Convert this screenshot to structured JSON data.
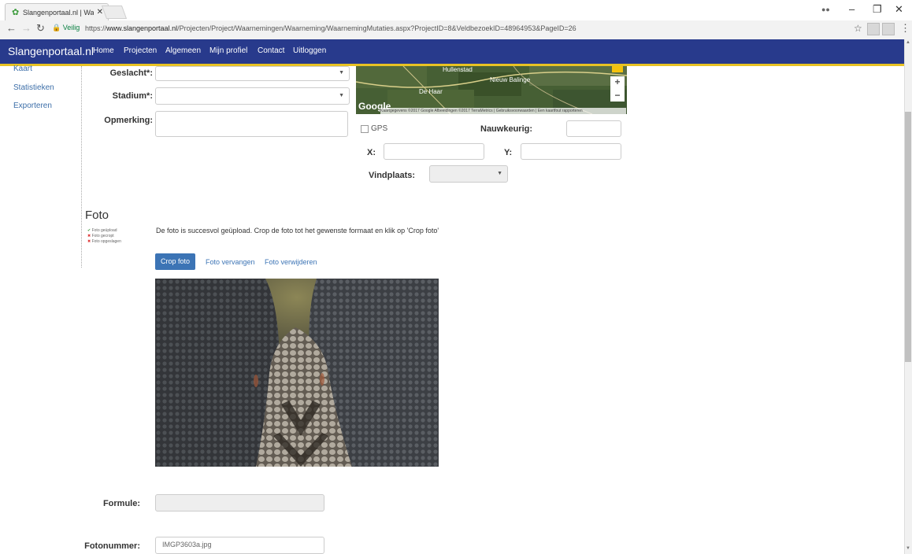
{
  "browser": {
    "tab_title": "Slangenportaal.nl | Waa",
    "secure_label": "Veilig",
    "url_prefix": "https://",
    "url_host": "www.slangenportaal.nl",
    "url_path": "/Projecten/Project/Waarnemingen/Waarneming/WaarnemingMutaties.aspx?ProjectID=8&VeldbezoekID=48964953&PageID=26"
  },
  "nav": {
    "brand": "Slangenportaal.nl",
    "items": [
      "Home",
      "Projecten",
      "Algemeen",
      "Mijn profiel",
      "Contact",
      "Uitloggen"
    ]
  },
  "sidebar": {
    "items": [
      "Kaart",
      "Statistieken",
      "Exporteren"
    ]
  },
  "form": {
    "geslacht_label": "Geslacht*:",
    "stadium_label": "Stadium*:",
    "opmerking_label": "Opmerking:",
    "gps_label": "GPS",
    "nauwkeurig_label": "Nauwkeurig:",
    "x_label": "X:",
    "y_label": "Y:",
    "vindplaats_label": "Vindplaats:",
    "formule_label": "Formule:",
    "fotonummer_label": "Fotonummer:",
    "fotonummer_value": "IMGP3603a.jpg"
  },
  "map": {
    "places": [
      "Hullenstad",
      "Nieuw Balinge",
      "De Haar"
    ],
    "google": "Google",
    "attribution": "Kaartgegevens ©2017 Google Afbeeldingen ©2017 TerraMetrics | Gebruiksvoorwaarden | Een kaartfout rapporteren"
  },
  "foto": {
    "heading": "Foto",
    "status": [
      "Foto geüpload",
      "Foto gecropt",
      "Foto opgeslagen"
    ],
    "message": "De foto is succesvol geüpload. Crop de foto tot het gewenste formaat en klik op 'Crop foto'",
    "crop_button": "Crop foto",
    "replace_link": "Foto vervangen",
    "delete_link": "Foto verwijderen"
  }
}
